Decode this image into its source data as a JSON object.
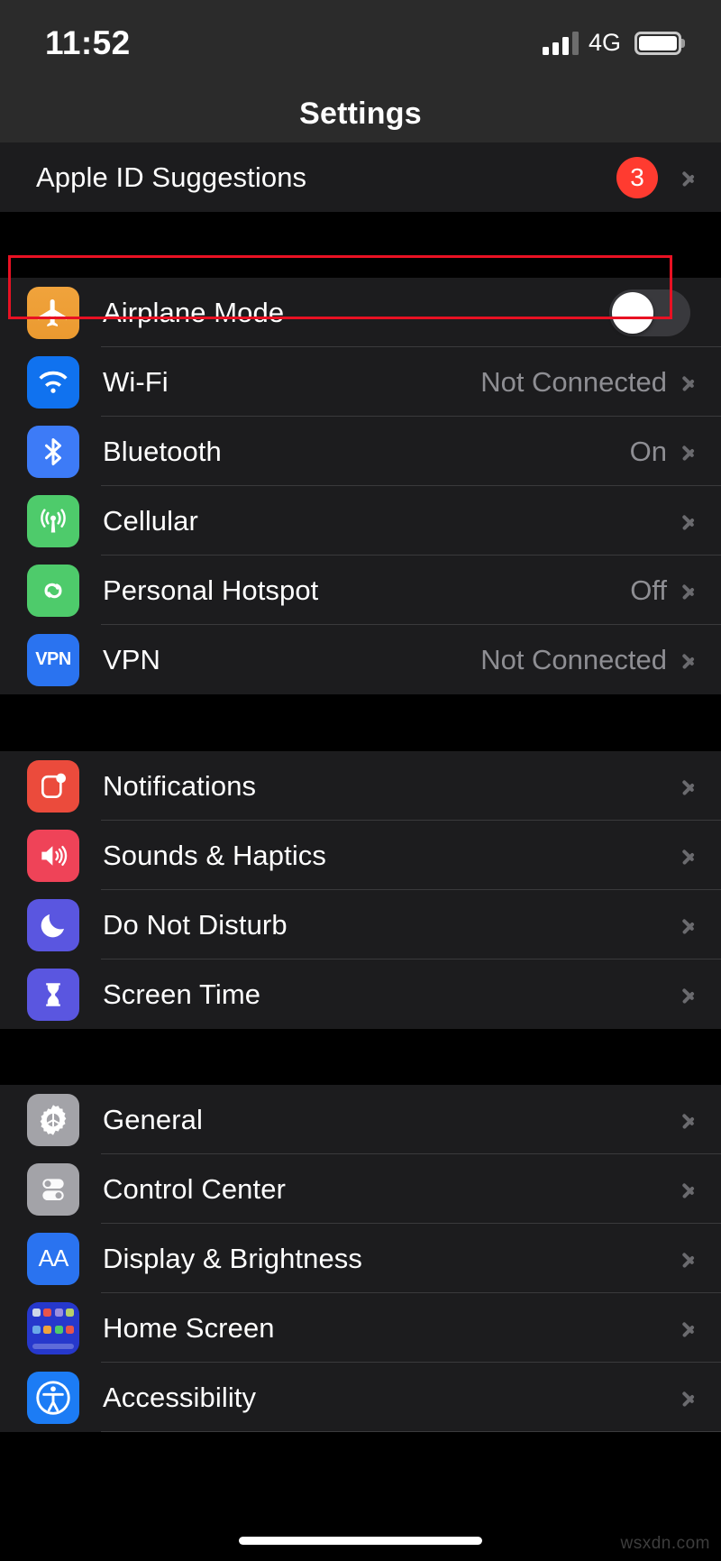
{
  "status_bar": {
    "time": "11:52",
    "network_type": "4G",
    "signal_bars_filled": 3,
    "signal_bars_total": 4,
    "battery_level_full": true,
    "signal_icon": "cellular-signal-icon",
    "battery_icon": "battery-full-icon"
  },
  "navigation": {
    "title": "Settings"
  },
  "suggestions_group": {
    "rows": [
      {
        "label": "Apple ID Suggestions",
        "badge": "3",
        "accessory": "chevron",
        "icon": "none"
      }
    ]
  },
  "connectivity_group": {
    "rows": [
      {
        "label": "Airplane Mode",
        "value": "",
        "accessory": "toggle",
        "toggle_on": false,
        "icon": "airplane-icon",
        "icon_color": "#f0a33c",
        "highlighted": true
      },
      {
        "label": "Wi-Fi",
        "value": "Not Connected",
        "accessory": "chevron",
        "icon": "wifi-icon",
        "icon_color": "#1072ef"
      },
      {
        "label": "Bluetooth",
        "value": "On",
        "accessory": "chevron",
        "icon": "bluetooth-icon",
        "icon_color": "#3d7bf7"
      },
      {
        "label": "Cellular",
        "value": "",
        "accessory": "chevron",
        "icon": "cellular-icon",
        "icon_color": "#4ecb6b"
      },
      {
        "label": "Personal Hotspot",
        "value": "Off",
        "accessory": "chevron",
        "icon": "hotspot-icon",
        "icon_color": "#4ecb6b"
      },
      {
        "label": "VPN",
        "value": "Not Connected",
        "accessory": "chevron",
        "icon": "vpn-icon",
        "icon_color": "#2a73f0",
        "icon_text": "VPN"
      }
    ]
  },
  "notifications_group": {
    "rows": [
      {
        "label": "Notifications",
        "value": "",
        "accessory": "chevron",
        "icon": "notifications-icon",
        "icon_color": "#eb4b3c"
      },
      {
        "label": "Sounds & Haptics",
        "value": "",
        "accessory": "chevron",
        "icon": "speaker-icon",
        "icon_color": "#ef4358"
      },
      {
        "label": "Do Not Disturb",
        "value": "",
        "accessory": "chevron",
        "icon": "moon-icon",
        "icon_color": "#5a56e0"
      },
      {
        "label": "Screen Time",
        "value": "",
        "accessory": "chevron",
        "icon": "hourglass-icon",
        "icon_color": "#5a56e0"
      }
    ]
  },
  "system_group": {
    "rows": [
      {
        "label": "General",
        "value": "",
        "accessory": "chevron",
        "icon": "gear-icon",
        "icon_color": "#a3a3a8"
      },
      {
        "label": "Control Center",
        "value": "",
        "accessory": "chevron",
        "icon": "sliders-icon",
        "icon_color": "#a3a3a8"
      },
      {
        "label": "Display & Brightness",
        "value": "",
        "accessory": "chevron",
        "icon": "text-size-icon",
        "icon_color": "#2a73f0",
        "icon_text": "AA"
      },
      {
        "label": "Home Screen",
        "value": "",
        "accessory": "chevron",
        "icon": "app-grid-icon",
        "icon_color": "#2638cc"
      },
      {
        "label": "Accessibility",
        "value": "",
        "accessory": "chevron",
        "icon": "accessibility-icon",
        "icon_color": "#1c7cf5"
      }
    ]
  },
  "annotation": {
    "highlight_color": "#e81123",
    "highlight_target": "Airplane Mode"
  },
  "watermark": {
    "text": "wsxdn.com"
  }
}
